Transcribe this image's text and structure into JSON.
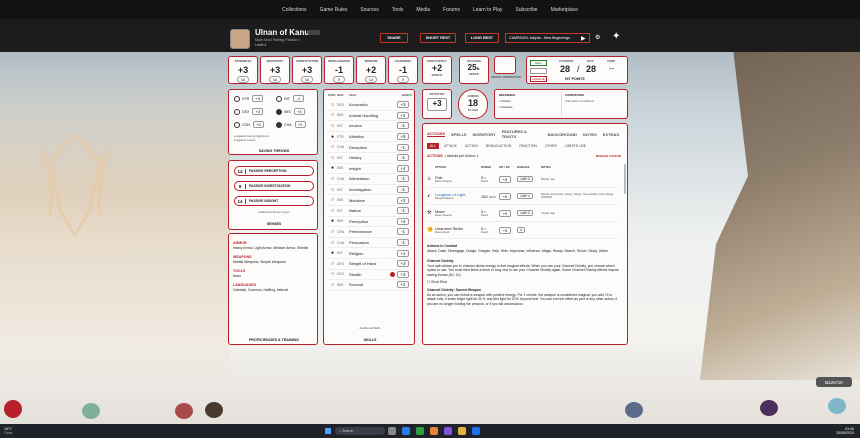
{
  "topnav": [
    "Collections",
    "Game Rules",
    "Sources",
    "Tools",
    "Media",
    "Forums",
    "Learn to Play",
    "Subscribe",
    "Marketplace"
  ],
  "header": {
    "name": "Ulnan of Kanus",
    "badge": "",
    "subtitle": "Male  Stout Halfling  Paladin 4",
    "level": "Level 4",
    "buttons": [
      "SHARE",
      "SHORT REST",
      "LONG REST"
    ],
    "campaign": "CAMPAIGN: Aalyria - New Beginnings"
  },
  "abilities": [
    {
      "label": "STRENGTH",
      "mod": "+3",
      "score": "16"
    },
    {
      "label": "DEXTERITY",
      "mod": "+3",
      "score": "16"
    },
    {
      "label": "CONSTITUTION",
      "mod": "+3",
      "score": "16"
    },
    {
      "label": "INTELLIGENCE",
      "mod": "-1",
      "score": "9"
    },
    {
      "label": "WISDOM",
      "mod": "+2",
      "score": "14"
    },
    {
      "label": "CHARISMA",
      "mod": "-1",
      "score": "9"
    }
  ],
  "proficiency": {
    "label": "PROFICIENCY",
    "value": "+2",
    "sub": "BONUS"
  },
  "speed": {
    "label": "WALKING",
    "value": "25",
    "unit": "ft.",
    "sub": "SPEED"
  },
  "inspiration": {
    "label": "HEROIC INSPIRATION"
  },
  "hp": {
    "heal": "HEAL",
    "damage": "DAMAGE",
    "current_label": "CURRENT",
    "max_label": "MAX",
    "temp_label": "TEMP",
    "current": "28",
    "max": "28",
    "temp": "--",
    "title": "HIT POINTS"
  },
  "saves": {
    "items": [
      {
        "name": "STR",
        "val": "+3"
      },
      {
        "name": "INT",
        "val": "-1"
      },
      {
        "name": "DEX",
        "val": "+3"
      },
      {
        "name": "WIS",
        "val": "+4"
      },
      {
        "name": "CON",
        "val": "+3"
      },
      {
        "name": "CHA",
        "val": "+1"
      }
    ],
    "notes": [
      "against being frightened",
      "against poison"
    ],
    "title": "SAVING THROWS"
  },
  "senses": {
    "items": [
      {
        "val": "14",
        "name": "PASSIVE PERCEPTION"
      },
      {
        "val": "9",
        "name": "PASSIVE INVESTIGATION"
      },
      {
        "val": "14",
        "name": "PASSIVE INSIGHT"
      }
    ],
    "extra": "Additional Sense Types",
    "title": "SENSES"
  },
  "proficiencies": {
    "sections": [
      {
        "title": "ARMOR",
        "text": "Heavy Armor, Light Armor, Medium Armor, Shields"
      },
      {
        "title": "WEAPONS",
        "text": "Martial Weapons, Simple Weapons"
      },
      {
        "title": "TOOLS",
        "text": "None"
      },
      {
        "title": "LANGUAGES",
        "text": "Celestial, Common, Halfling, Infernal"
      }
    ],
    "title": "PROFICIENCIES & TRAINING"
  },
  "skills": {
    "headers": [
      "PROF",
      "MOD",
      "SKILL",
      "BONUS"
    ],
    "items": [
      {
        "p": "○",
        "m": "DEX",
        "n": "Acrobatics",
        "b": "+3"
      },
      {
        "p": "○",
        "m": "WIS",
        "n": "Animal Handling",
        "b": "+2"
      },
      {
        "p": "○",
        "m": "INT",
        "n": "Arcana",
        "b": "-1"
      },
      {
        "p": "●",
        "m": "STR",
        "n": "Athletics",
        "b": "+5"
      },
      {
        "p": "○",
        "m": "CHA",
        "n": "Deception",
        "b": "-1"
      },
      {
        "p": "○",
        "m": "INT",
        "n": "History",
        "b": "-1"
      },
      {
        "p": "●",
        "m": "WIS",
        "n": "Insight",
        "b": "+4"
      },
      {
        "p": "○",
        "m": "CHA",
        "n": "Intimidation",
        "b": "-1"
      },
      {
        "p": "○",
        "m": "INT",
        "n": "Investigation",
        "b": "-1"
      },
      {
        "p": "○",
        "m": "WIS",
        "n": "Medicine",
        "b": "+2"
      },
      {
        "p": "○",
        "m": "INT",
        "n": "Nature",
        "b": "-1"
      },
      {
        "p": "●",
        "m": "WIS",
        "n": "Perception",
        "b": "+4"
      },
      {
        "p": "○",
        "m": "CHA",
        "n": "Performance",
        "b": "-1"
      },
      {
        "p": "○",
        "m": "CHA",
        "n": "Persuasion",
        "b": "-1"
      },
      {
        "p": "●",
        "m": "INT",
        "n": "Religion",
        "b": "+1"
      },
      {
        "p": "○",
        "m": "DEX",
        "n": "Sleight of Hand",
        "b": "+3"
      },
      {
        "p": "○",
        "m": "DEX",
        "n": "Stealth",
        "b": "+3"
      },
      {
        "p": "○",
        "m": "WIS",
        "n": "Survival",
        "b": "+2"
      }
    ],
    "extra": "Additional Skills",
    "title": "SKILLS"
  },
  "initiative": {
    "label": "INITIATIVE",
    "value": "+3"
  },
  "armor": {
    "label": "ARMOR",
    "value": "18",
    "sub": "CLASS"
  },
  "defenses": {
    "title": "DEFENSES",
    "items": [
      "Poison",
      "Disease"
    ]
  },
  "conditions": {
    "title": "CONDITIONS",
    "add": "Add Active Conditions"
  },
  "actions": {
    "tabs": [
      "ACTIONS",
      "SPELLS",
      "INVENTORY",
      "FEATURES & TRAITS",
      "BACKGROUND",
      "NOTES",
      "EXTRAS"
    ],
    "filters": [
      "ALL",
      "ATTACK",
      "ACTION",
      "BONUS ACTION",
      "REACTION",
      "OTHER",
      "LIMITED USE"
    ],
    "heading": "ACTIONS",
    "per_action": "• Attacks per Action: 1",
    "manage": "MANAGE CUSTOM",
    "cols": [
      "ATTACK",
      "RANGE",
      "HIT / DC",
      "DAMAGE",
      "NOTES"
    ],
    "attacks": [
      {
        "name": "Flail",
        "type": "Melee Weapon",
        "range": "5",
        "runit": "ft.",
        "rsub": "Reach",
        "hit": "+5",
        "dmg": "1d8+3",
        "notes": "Martial, Sap"
      },
      {
        "name": "Longbow of Light",
        "type": "Ranged Weapon",
        "range": "150",
        "runit": "(600)",
        "rsub": "",
        "hit": "+6",
        "dmg": "1d8+4",
        "notes": "Martial, Ammunition, Heavy, Range, Two-Handed, Slow, Range (150/600)"
      },
      {
        "name": "Mace",
        "type": "Melee Weapon",
        "range": "5",
        "runit": "ft.",
        "rsub": "Reach",
        "hit": "+5",
        "dmg": "1d6+3",
        "notes": "Simple, Sap"
      },
      {
        "name": "Unarmed Strike",
        "type": "Melee Attack",
        "range": "5",
        "runit": "ft.",
        "rsub": "Reach",
        "hit": "+5",
        "dmg": "4",
        "notes": ""
      }
    ],
    "combat_title": "Actions in Combat",
    "combat_text": "Attack, Dash, Disengage, Dodge, Grapple, Help, Hide, Improvise, Influence, Magic, Ready, Search, Shove, Study, Utilize",
    "cd_title": "Channel Divinity",
    "cd_text": "Your oath allows you to channel divine energy to fuel magical effects. When you use your Channel Divinity, you choose which option to use. You must then finish a short or long rest to use your Channel Divinity again. Some Channel Divinity effects require saving throws (DC 12).",
    "cd_rest": "Short Rest",
    "sw_title": "Channel Divinity: Sacred Weapon",
    "sw_text": "As an action, you can imbue a weapon with positive energy. For 1 minute, the weapon is considered magical, you add +2 to attack rolls, it emits bright light for 20 ft. and dim light for 20 ft. beyond that. You can end the effect as part of any other action, if you are no longer holding the weapon, or if you fall unconscious."
  },
  "dice_widget": {
    "value": "12671K"
  },
  "taskbar": {
    "weather": "16°C",
    "weather_sub": "Clear",
    "search": "Search",
    "time": "03:46",
    "date": "25/08/2025"
  },
  "colors": {
    "accent": "#b7202a",
    "header": "#1c1c1c",
    "nav": "#121212"
  }
}
